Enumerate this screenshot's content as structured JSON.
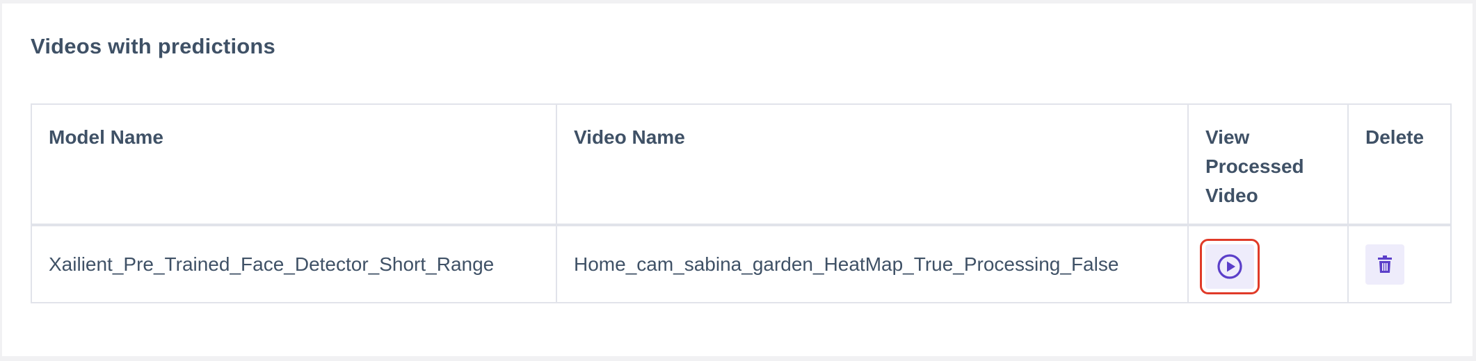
{
  "page": {
    "title": "Videos with predictions"
  },
  "table": {
    "headers": {
      "model_name": "Model Name",
      "video_name": "Video Name",
      "view_processed_video": "View Processed Video",
      "delete": "Delete"
    },
    "rows": [
      {
        "model_name": "Xailient_Pre_Trained_Face_Detector_Short_Range",
        "video_name": "Home_cam_sabina_garden_HeatMap_True_Processing_False",
        "view_icon": "play-circle-icon",
        "delete_icon": "trash-icon"
      }
    ]
  },
  "colors": {
    "text": "#3f5166",
    "accent": "#5b3fc9",
    "button_bg": "#eeecfb",
    "highlight": "#e03a28",
    "border": "#e1e3ea"
  }
}
